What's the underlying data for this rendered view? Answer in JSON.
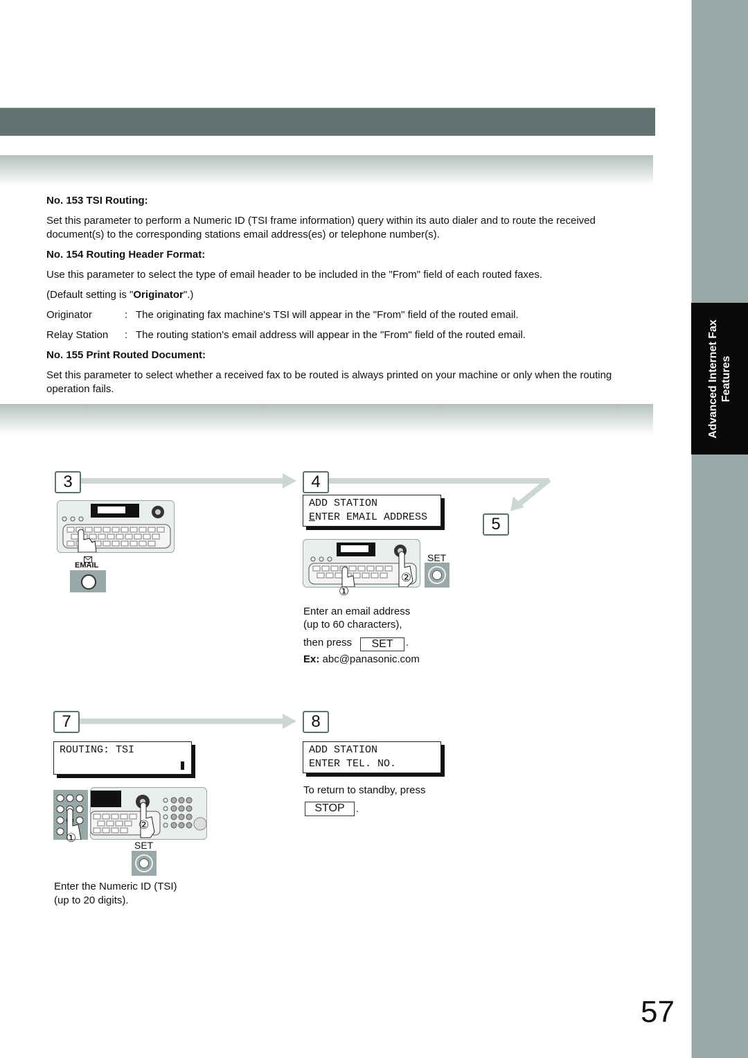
{
  "side_tab": {
    "line1": "Advanced Internet Fax",
    "line2": "Features"
  },
  "params": [
    {
      "heading": "No. 153 TSI Routing:",
      "body": "Set this parameter to perform a Numeric ID (TSI frame information) query within its auto dialer and to route the received document(s) to the corresponding stations email address(es) or telephone number(s)."
    },
    {
      "heading": "No. 154 Routing Header Format:",
      "body": "Use this parameter to select the type of email header to be included in the \"From\" field of each routed faxes.",
      "default_prefix": "(Default setting is \"",
      "default_value": "Originator",
      "default_suffix": "\".)",
      "options": [
        {
          "term": "Originator",
          "sep": ":",
          "desc": "The originating fax machine's TSI will appear in the \"From\" field of the routed email."
        },
        {
          "term": "Relay Station",
          "sep": ":",
          "desc": "The routing station's email address will appear in the \"From\" field of the routed email."
        }
      ]
    },
    {
      "heading": "No. 155 Print Routed Document:",
      "body": "Set this parameter to select whether a received fax to be routed is always printed on your machine or only when the routing operation fails."
    }
  ],
  "steps": {
    "s3": {
      "num": "3",
      "key_label": "EMAIL"
    },
    "s4": {
      "num": "4",
      "lcd_line1": "ADD STATION",
      "lcd_line2": "ENTER EMAIL ADDRESS",
      "set_label": "SET",
      "callout1": "①",
      "callout2": "②",
      "desc1": "Enter an email address",
      "desc2": "(up to 60 characters),",
      "then_press": "then press",
      "button": "SET",
      "period": ".",
      "ex_label": "Ex:",
      "ex_value": "abc@panasonic.com"
    },
    "s5": {
      "num": "5"
    },
    "s7": {
      "num": "7",
      "lcd_line1": "ROUTING: TSI",
      "lcd_line2": "",
      "set_label": "SET",
      "callout1": "①",
      "callout2": "②",
      "desc1": "Enter the Numeric ID (TSI)",
      "desc2": "(up to 20 digits)."
    },
    "s8": {
      "num": "8",
      "lcd_line1": "ADD STATION",
      "lcd_line2": "ENTER TEL. NO.",
      "desc": "To return to standby, press",
      "button": "STOP",
      "period": "."
    }
  },
  "page_number": "57",
  "colors": {
    "header_bar": "#637371",
    "side_strip": "#98a8a6",
    "side_tab": "#0a0a0a",
    "arrow": "#cbd6d5"
  }
}
